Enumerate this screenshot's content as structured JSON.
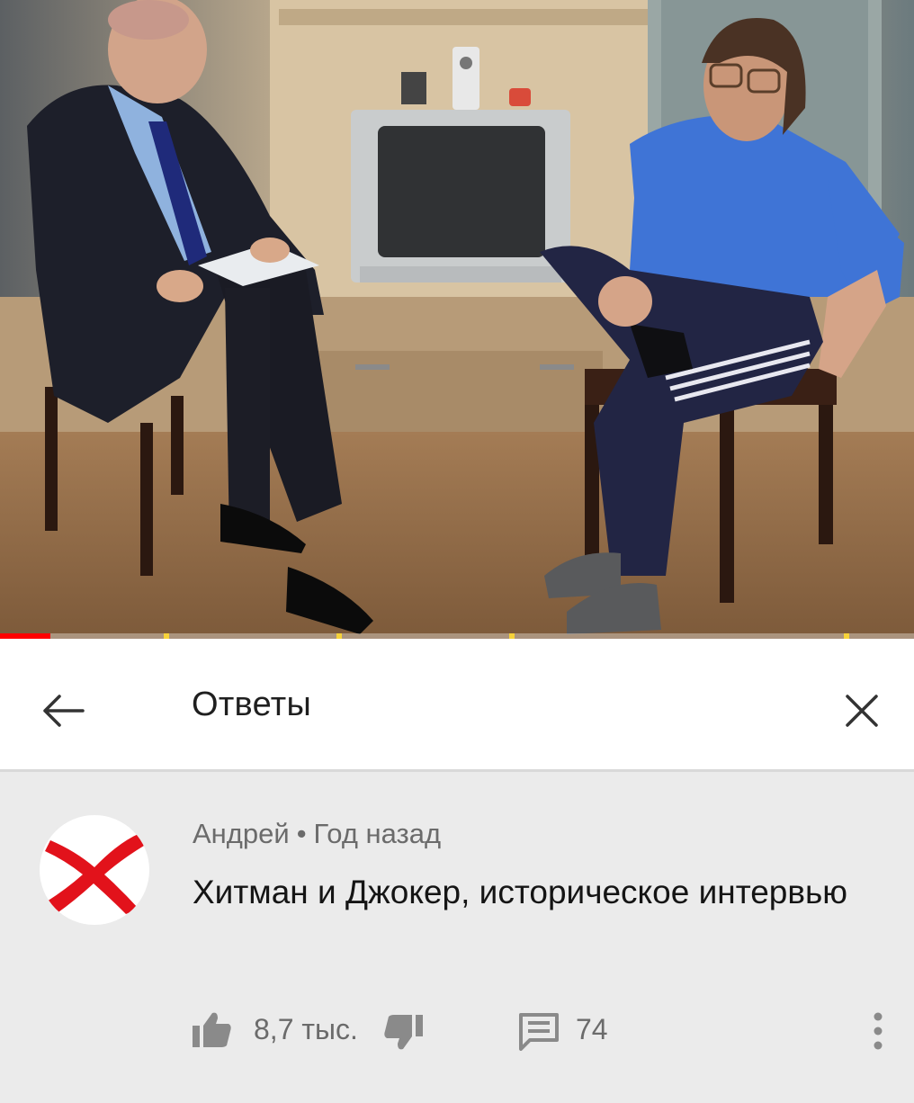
{
  "video": {
    "progress_fraction": 0.055
  },
  "replies_panel": {
    "title": "Ответы",
    "back_icon": "arrow-left-icon",
    "close_icon": "close-icon"
  },
  "comment": {
    "author": "Андрей",
    "separator": "•",
    "time": "Год назад",
    "text": "Хитман и Джокер, историческое интервью",
    "avatar_icon": "red-cross-icon",
    "likes": "8,7 тыс.",
    "replies": "74",
    "like_icon": "thumbs-up-icon",
    "dislike_icon": "thumbs-down-icon",
    "reply_icon": "comment-icon",
    "more_icon": "more-vertical-icon"
  },
  "colors": {
    "accent_red": "#ff0000",
    "avatar_cross": "#e2121b",
    "ad_marker": "#f6d23a"
  }
}
